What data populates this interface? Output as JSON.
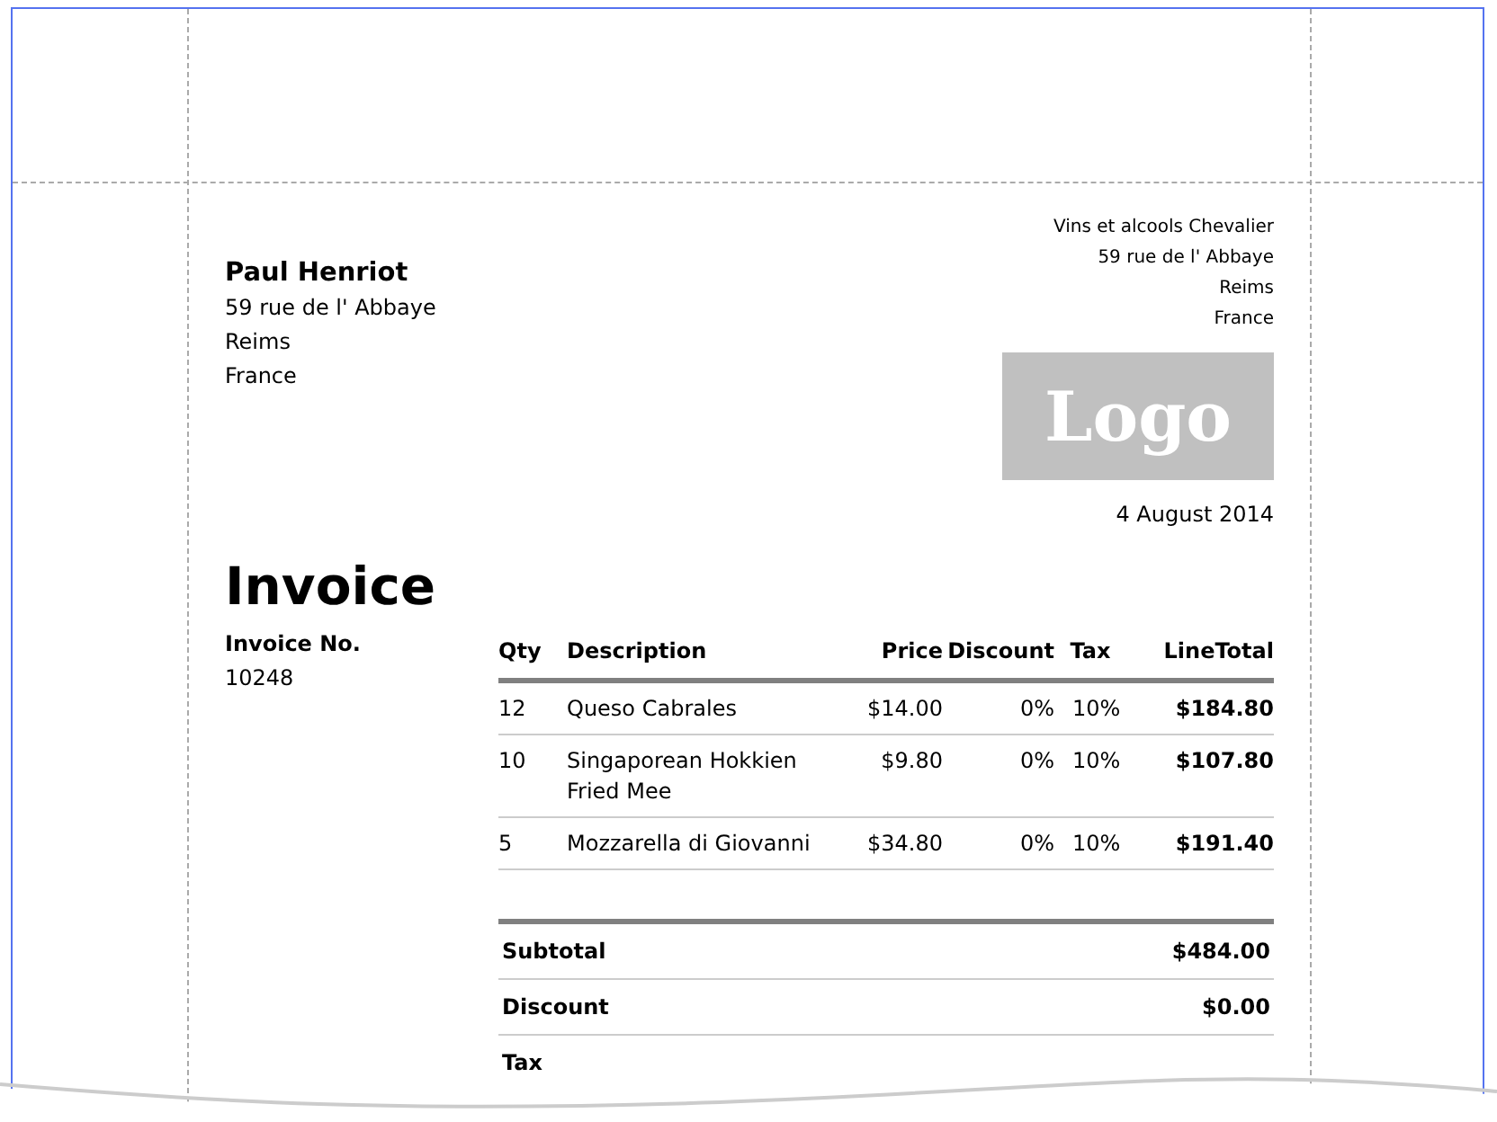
{
  "customer": {
    "name": "Paul Henriot",
    "address_lines": [
      "59 rue de l' Abbaye",
      "Reims",
      "France"
    ]
  },
  "company": {
    "lines": [
      "Vins et alcools Chevalier",
      "59 rue de l' Abbaye",
      "Reims",
      "France"
    ],
    "logo": "Logo",
    "date": "4 August 2014"
  },
  "title": "Invoice",
  "invoice_number": {
    "label": "Invoice No.",
    "value": "10248"
  },
  "table": {
    "columns": [
      "Qty",
      "Description",
      "Price",
      "Discount",
      "Tax",
      "LineTotal"
    ],
    "rows": [
      {
        "qty": "12",
        "description": "Queso Cabrales",
        "price": "$14.00",
        "discount": "0%",
        "tax": "10%",
        "line_total": "$184.80"
      },
      {
        "qty": "10",
        "description": "Singaporean Hokkien Fried Mee",
        "price": "$9.80",
        "discount": "0%",
        "tax": "10%",
        "line_total": "$107.80"
      },
      {
        "qty": "5",
        "description": "Mozzarella di Giovanni",
        "price": "$34.80",
        "discount": "0%",
        "tax": "10%",
        "line_total": "$191.40"
      }
    ]
  },
  "totals": [
    {
      "label": "Subtotal",
      "value": "$484.00"
    },
    {
      "label": "Discount",
      "value": "$0.00"
    },
    {
      "label": "Tax"
    }
  ]
}
